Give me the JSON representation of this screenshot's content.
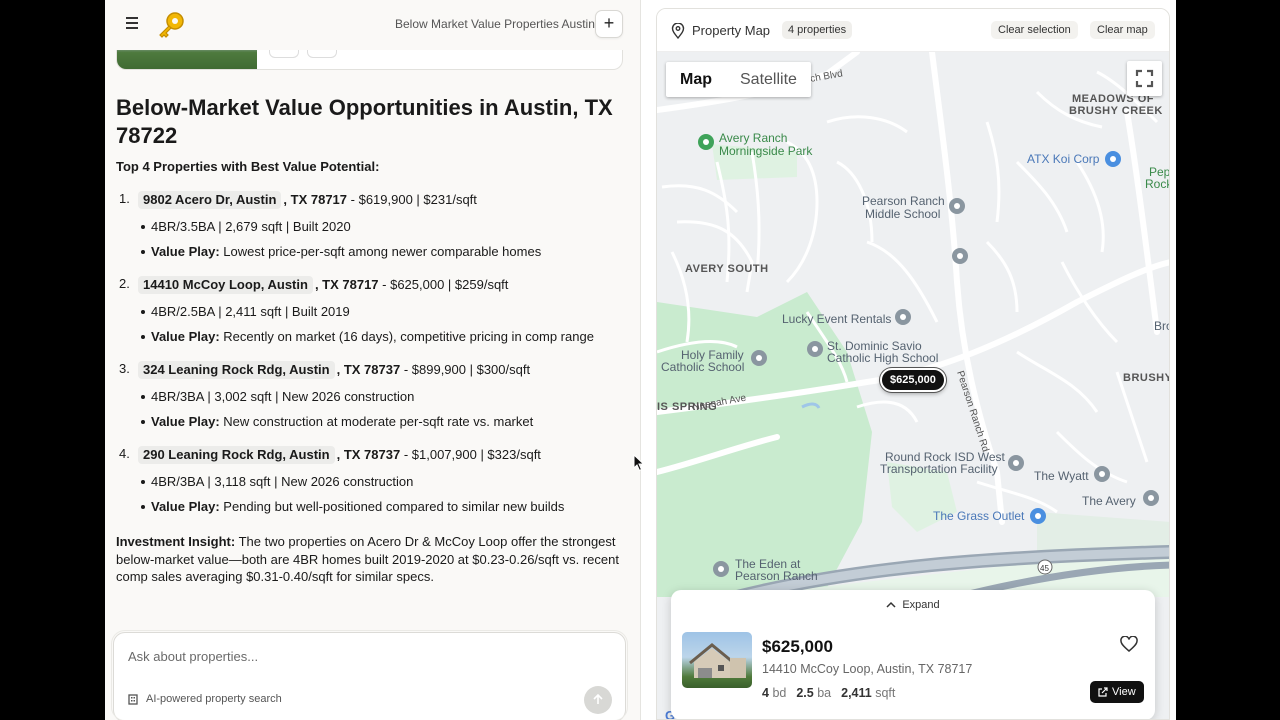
{
  "chat": {
    "header_title": "Below Market Value Properties Austin",
    "new_label": "+",
    "heading": "Below-Market Value Opportunities in Austin, TX 78722",
    "subheading": "Top 4 Properties with Best Value Potential:",
    "properties": [
      {
        "num": "1.",
        "address": "9802 Acero Dr, Austin",
        "zip": ", TX 78717",
        "summary": " - $619,900 | $231/sqft",
        "specs": "4BR/3.5BA | 2,679 sqft | Built 2020",
        "value_label": "Value Play:",
        "value_text": " Lowest price-per-sqft among newer comparable homes"
      },
      {
        "num": "2.",
        "address": "14410 McCoy Loop, Austin",
        "zip": ", TX 78717",
        "summary": " - $625,000 | $259/sqft",
        "specs": "4BR/2.5BA | 2,411 sqft | Built 2019",
        "value_label": "Value Play:",
        "value_text": " Recently on market (16 days), competitive pricing in comp range"
      },
      {
        "num": "3.",
        "address": "324 Leaning Rock Rdg, Austin",
        "zip": ", TX 78737",
        "summary": " - $899,900 | $300/sqft",
        "specs": "4BR/3BA | 3,002 sqft | New 2026 construction",
        "value_label": "Value Play:",
        "value_text": " New construction at moderate per-sqft rate vs. market"
      },
      {
        "num": "4.",
        "address": "290 Leaning Rock Rdg, Austin",
        "zip": ", TX 78737",
        "summary": " - $1,007,900 | $323/sqft",
        "specs": "4BR/3BA | 3,118 sqft | New 2026 construction",
        "value_label": "Value Play:",
        "value_text": " Pending but well-positioned compared to similar new builds"
      }
    ],
    "insight_label": "Investment Insight:",
    "insight_text": " The two properties on Acero Dr & McCoy Loop offer the strongest below-market value—both are 4BR homes built 2019-2020 at $0.23-0.26/sqft vs. recent comp sales averaging $0.31-0.40/sqft for similar specs.",
    "input_placeholder": "Ask about properties...",
    "ai_label": "AI-powered property search"
  },
  "map": {
    "title": "Property Map",
    "count_badge": "4 properties",
    "clear_selection": "Clear selection",
    "clear_map": "Clear map",
    "maptype_map": "Map",
    "maptype_satellite": "Satellite",
    "marker_price": "$625,000",
    "google_label": "Google",
    "labels": {
      "avery_ranch_blvd": "Avery Ranch Blvd",
      "avery_ranch_park_1": "Avery Ranch",
      "avery_ranch_park_2": "Morningside Park",
      "pearson_ranch_ms_1": "Pearson Ranch",
      "pearson_ranch_ms_2": "Middle School",
      "avery_south": "AVERY SOUTH",
      "lucky_event": "Lucky Event Rentals",
      "holy_family_1": "Holy Family",
      "holy_family_2": "Catholic School",
      "st_dominic_1": "St. Dominic Savio",
      "st_dominic_2": "Catholic High School",
      "meadows_1": "MEADOWS OF",
      "meadows_2": "BRUSHY CREEK",
      "atx_koi": "ATX Koi Corp",
      "rr_isd_1": "Round Rock ISD West",
      "rr_isd_2": "Transportation Facility",
      "the_wyatt": "The Wyatt",
      "the_avery": "The Avery",
      "grass_outlet": "The Grass Outlet",
      "eden_1": "The Eden at",
      "eden_2": "Pearson Ranch",
      "is_spring": "IS SPRING",
      "neenah_ave": "Neenah Ave",
      "pearson_ranch_rd": "Pearson Ranch Rd",
      "brushy": "BRUSHY",
      "brool": "Brool",
      "pep_1": "Pep",
      "pep_2": "Rock",
      "route": "45"
    },
    "card": {
      "expand_label": "Expand",
      "price": "$625,000",
      "address": "14410 McCoy Loop, Austin, TX 78717",
      "beds": "4",
      "beds_unit": "bd",
      "baths": "2.5",
      "baths_unit": "ba",
      "sqft": "2,411",
      "sqft_unit": "sqft",
      "view_label": "View"
    }
  },
  "colors": {
    "map_bg": "#eef0f2",
    "park_green": "#c8ebcf",
    "road": "#ffffff",
    "highway": "#9aa7b4",
    "poi_grey": "#7b8a96",
    "poi_blue": "#4a8fe0",
    "poi_green": "#3fa35a"
  }
}
